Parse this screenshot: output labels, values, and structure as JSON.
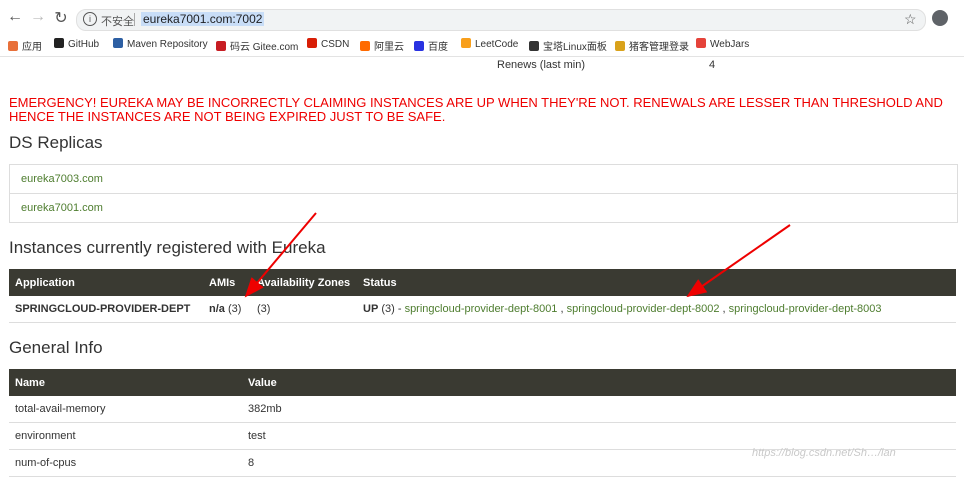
{
  "browser": {
    "omnibox": {
      "insecure_label": "不安全",
      "url": "eureka7001.com:7002"
    },
    "bookmarks": [
      {
        "label": "应用",
        "color": "#e8703a"
      },
      {
        "label": "GitHub",
        "color": "#222222"
      },
      {
        "label": "Maven Repository",
        "color": "#2d5fa3"
      },
      {
        "label": "码云 Gitee.com",
        "color": "#c71d23"
      },
      {
        "label": "CSDN",
        "color": "#d81e06"
      },
      {
        "label": "阿里云",
        "color": "#ff6a00"
      },
      {
        "label": "百度",
        "color": "#2932e1"
      },
      {
        "label": "LeetCode",
        "color": "#f89f1b"
      },
      {
        "label": "宝塔Linux面板",
        "color": "#333333"
      },
      {
        "label": "猪客管理登录",
        "color": "#d9a21b"
      },
      {
        "label": "WebJars",
        "color": "#e5433a"
      }
    ]
  },
  "stats": {
    "renews_label": "Renews (last min)",
    "renews_value": "4"
  },
  "emergency": {
    "line1": "EMERGENCY! EUREKA MAY BE INCORRECTLY CLAIMING INSTANCES ARE UP WHEN THEY'RE NOT. RENEWALS ARE LESSER THAN THRESHOLD AND",
    "line2": "HENCE THE INSTANCES ARE NOT BEING EXPIRED JUST TO BE SAFE."
  },
  "replicas": {
    "title": "DS Replicas",
    "items": [
      "eureka7003.com",
      "eureka7001.com"
    ]
  },
  "instances": {
    "title": "Instances currently registered with Eureka",
    "headers": [
      "Application",
      "AMIs",
      "Availability Zones",
      "Status"
    ],
    "row": {
      "application": "SPRINGCLOUD-PROVIDER-DEPT",
      "amis_bold": "n/a",
      "amis_count": " (3)",
      "zones": "(3)",
      "status_up": "UP",
      "status_count": " (3) - ",
      "links": [
        "springcloud-provider-dept-8001",
        "springcloud-provider-dept-8002",
        "springcloud-provider-dept-8003"
      ],
      "sep": " , "
    }
  },
  "general": {
    "title": "General Info",
    "headers": [
      "Name",
      "Value"
    ],
    "rows": [
      {
        "name": "total-avail-memory",
        "value": "382mb"
      },
      {
        "name": "environment",
        "value": "test"
      },
      {
        "name": "num-of-cpus",
        "value": "8"
      }
    ]
  },
  "watermark": "https://blog.csdn.net/Sh…/lan"
}
